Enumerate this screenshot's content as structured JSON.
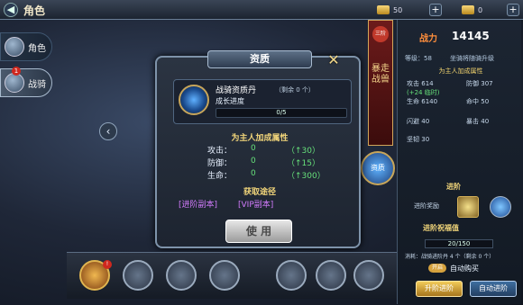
{
  "header": {
    "title": "角色",
    "gold": "50",
    "diamond": "0"
  },
  "sidebar": {
    "items": [
      {
        "label": "角色"
      },
      {
        "label": "战骑",
        "badge": "1"
      }
    ]
  },
  "dialog": {
    "title": "资质",
    "item_name": "战骑资质丹",
    "item_remain": "（剩余 0 个）",
    "growth_label": "成长进度",
    "progress_text": "0/5",
    "progress_value": 0.0,
    "bonus_title": "为主人加成属性",
    "stats": [
      {
        "label": "攻击：",
        "value": "0",
        "bonus": "（↑30）"
      },
      {
        "label": "防御：",
        "value": "0",
        "bonus": "（↑15）"
      },
      {
        "label": "生命：",
        "value": "0",
        "bonus": "（↑300）"
      }
    ],
    "source_title": "获取途径",
    "sources": [
      "[进阶副本]",
      "[VIP副本]"
    ],
    "use_label": "使 用"
  },
  "right": {
    "power_label": "战力",
    "power_value": "14145",
    "level_label": "等级：58",
    "level_note": "坐骑将随骑升级",
    "bonus_head": "为主人加成属性",
    "stats": [
      {
        "label": "攻击",
        "value": "614",
        "extra": "(+24 临时)"
      },
      {
        "label": "防御",
        "value": "307"
      },
      {
        "label": "生命",
        "value": "6140"
      },
      {
        "label": "命中",
        "value": "50"
      },
      {
        "label": "闪避",
        "value": "40"
      },
      {
        "label": "暴击",
        "value": "40"
      },
      {
        "label": "坚韧",
        "value": "30"
      }
    ],
    "advance_title": "进阶",
    "advance_reward": "进阶奖励",
    "bless_title": "进阶祝福值",
    "bless_value": "20/150",
    "consume": "消耗：战骑进阶丹 4 个（剩余 0 个）",
    "toggle_label": "开启",
    "auto_buy": "自动购买",
    "btn_advance": "升阶进阶",
    "btn_auto": "自动进阶"
  },
  "banner": {
    "text": "暴走战兽",
    "badge": "三阶"
  },
  "dial_label": "资质"
}
